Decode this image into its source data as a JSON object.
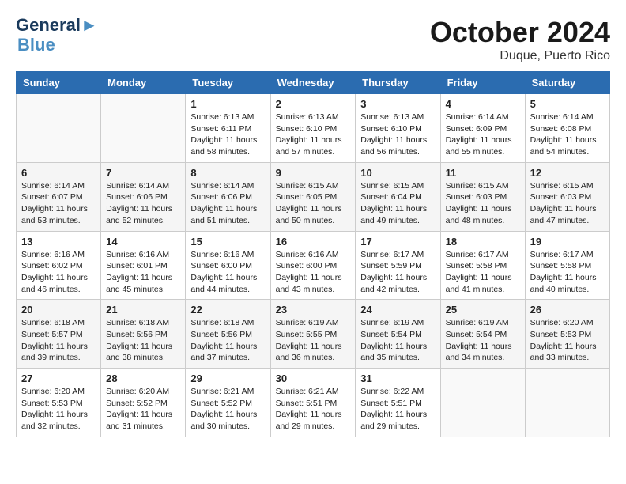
{
  "header": {
    "logo_line1": "General",
    "logo_line2": "Blue",
    "month": "October 2024",
    "location": "Duque, Puerto Rico"
  },
  "weekdays": [
    "Sunday",
    "Monday",
    "Tuesday",
    "Wednesday",
    "Thursday",
    "Friday",
    "Saturday"
  ],
  "weeks": [
    [
      {
        "day": "",
        "info": ""
      },
      {
        "day": "",
        "info": ""
      },
      {
        "day": "1",
        "info": "Sunrise: 6:13 AM\nSunset: 6:11 PM\nDaylight: 11 hours and 58 minutes."
      },
      {
        "day": "2",
        "info": "Sunrise: 6:13 AM\nSunset: 6:10 PM\nDaylight: 11 hours and 57 minutes."
      },
      {
        "day": "3",
        "info": "Sunrise: 6:13 AM\nSunset: 6:10 PM\nDaylight: 11 hours and 56 minutes."
      },
      {
        "day": "4",
        "info": "Sunrise: 6:14 AM\nSunset: 6:09 PM\nDaylight: 11 hours and 55 minutes."
      },
      {
        "day": "5",
        "info": "Sunrise: 6:14 AM\nSunset: 6:08 PM\nDaylight: 11 hours and 54 minutes."
      }
    ],
    [
      {
        "day": "6",
        "info": "Sunrise: 6:14 AM\nSunset: 6:07 PM\nDaylight: 11 hours and 53 minutes."
      },
      {
        "day": "7",
        "info": "Sunrise: 6:14 AM\nSunset: 6:06 PM\nDaylight: 11 hours and 52 minutes."
      },
      {
        "day": "8",
        "info": "Sunrise: 6:14 AM\nSunset: 6:06 PM\nDaylight: 11 hours and 51 minutes."
      },
      {
        "day": "9",
        "info": "Sunrise: 6:15 AM\nSunset: 6:05 PM\nDaylight: 11 hours and 50 minutes."
      },
      {
        "day": "10",
        "info": "Sunrise: 6:15 AM\nSunset: 6:04 PM\nDaylight: 11 hours and 49 minutes."
      },
      {
        "day": "11",
        "info": "Sunrise: 6:15 AM\nSunset: 6:03 PM\nDaylight: 11 hours and 48 minutes."
      },
      {
        "day": "12",
        "info": "Sunrise: 6:15 AM\nSunset: 6:03 PM\nDaylight: 11 hours and 47 minutes."
      }
    ],
    [
      {
        "day": "13",
        "info": "Sunrise: 6:16 AM\nSunset: 6:02 PM\nDaylight: 11 hours and 46 minutes."
      },
      {
        "day": "14",
        "info": "Sunrise: 6:16 AM\nSunset: 6:01 PM\nDaylight: 11 hours and 45 minutes."
      },
      {
        "day": "15",
        "info": "Sunrise: 6:16 AM\nSunset: 6:00 PM\nDaylight: 11 hours and 44 minutes."
      },
      {
        "day": "16",
        "info": "Sunrise: 6:16 AM\nSunset: 6:00 PM\nDaylight: 11 hours and 43 minutes."
      },
      {
        "day": "17",
        "info": "Sunrise: 6:17 AM\nSunset: 5:59 PM\nDaylight: 11 hours and 42 minutes."
      },
      {
        "day": "18",
        "info": "Sunrise: 6:17 AM\nSunset: 5:58 PM\nDaylight: 11 hours and 41 minutes."
      },
      {
        "day": "19",
        "info": "Sunrise: 6:17 AM\nSunset: 5:58 PM\nDaylight: 11 hours and 40 minutes."
      }
    ],
    [
      {
        "day": "20",
        "info": "Sunrise: 6:18 AM\nSunset: 5:57 PM\nDaylight: 11 hours and 39 minutes."
      },
      {
        "day": "21",
        "info": "Sunrise: 6:18 AM\nSunset: 5:56 PM\nDaylight: 11 hours and 38 minutes."
      },
      {
        "day": "22",
        "info": "Sunrise: 6:18 AM\nSunset: 5:56 PM\nDaylight: 11 hours and 37 minutes."
      },
      {
        "day": "23",
        "info": "Sunrise: 6:19 AM\nSunset: 5:55 PM\nDaylight: 11 hours and 36 minutes."
      },
      {
        "day": "24",
        "info": "Sunrise: 6:19 AM\nSunset: 5:54 PM\nDaylight: 11 hours and 35 minutes."
      },
      {
        "day": "25",
        "info": "Sunrise: 6:19 AM\nSunset: 5:54 PM\nDaylight: 11 hours and 34 minutes."
      },
      {
        "day": "26",
        "info": "Sunrise: 6:20 AM\nSunset: 5:53 PM\nDaylight: 11 hours and 33 minutes."
      }
    ],
    [
      {
        "day": "27",
        "info": "Sunrise: 6:20 AM\nSunset: 5:53 PM\nDaylight: 11 hours and 32 minutes."
      },
      {
        "day": "28",
        "info": "Sunrise: 6:20 AM\nSunset: 5:52 PM\nDaylight: 11 hours and 31 minutes."
      },
      {
        "day": "29",
        "info": "Sunrise: 6:21 AM\nSunset: 5:52 PM\nDaylight: 11 hours and 30 minutes."
      },
      {
        "day": "30",
        "info": "Sunrise: 6:21 AM\nSunset: 5:51 PM\nDaylight: 11 hours and 29 minutes."
      },
      {
        "day": "31",
        "info": "Sunrise: 6:22 AM\nSunset: 5:51 PM\nDaylight: 11 hours and 29 minutes."
      },
      {
        "day": "",
        "info": ""
      },
      {
        "day": "",
        "info": ""
      }
    ]
  ]
}
